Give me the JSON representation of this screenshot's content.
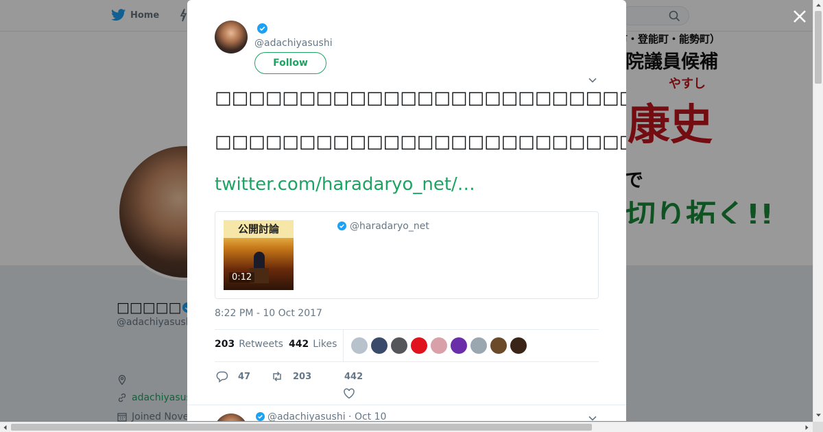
{
  "nav": {
    "home_label": "Home"
  },
  "banner": {
    "line1": "市・登能町・能勢町）",
    "line2": "院議員候補",
    "line3": "やすし",
    "line4": "康史",
    "line5": "で",
    "line6_a": "",
    "line6_b": "切り拓く!!"
  },
  "profile": {
    "name": "□□□□□",
    "handle": "@adachiyasushi",
    "website": "adachiyasush",
    "joined": "Joined Nove"
  },
  "tweet": {
    "handle": "@adachiyasushi",
    "follow_label": "Follow",
    "text_line1": "□□□□□□□□□□□□□□□□□□□□□□□□□□□□□□□□□□□□□□□□□□□□□□□□□□□□□□□",
    "text_line2": "□□□□□□□□□□□□□□□□□□□□□□□□□□□□□□□□□□□□□□□□□□□□□□□□□□□□□□□□□□□□□□□",
    "link": "twitter.com/haradaryo_net/…",
    "quote": {
      "handle": "@haradaryo_net",
      "video_duration": "0:12",
      "thumb_caption": "公開討論"
    },
    "timestamp": "8:22 PM - 10 Oct 2017",
    "stats": {
      "retweets_count": "203",
      "retweets_label": "Retweets",
      "likes_count": "442",
      "likes_label": "Likes"
    },
    "likers": [
      "#b8c2cc",
      "#3a4a6a",
      "#55565a",
      "#e0121e",
      "#d8a0a8",
      "#6a2fa8",
      "#9aa6b0",
      "#6b4a2a",
      "#3a2418"
    ],
    "actions": {
      "reply_count": "47",
      "retweet_count": "203",
      "like_count": "442"
    }
  },
  "next_tweet": {
    "handle_time": "@adachiyasushi · Oct 10"
  },
  "colors": {
    "accent": "#1da463",
    "verified": "#1da1f2",
    "twitter_blue": "#1da1f2"
  }
}
